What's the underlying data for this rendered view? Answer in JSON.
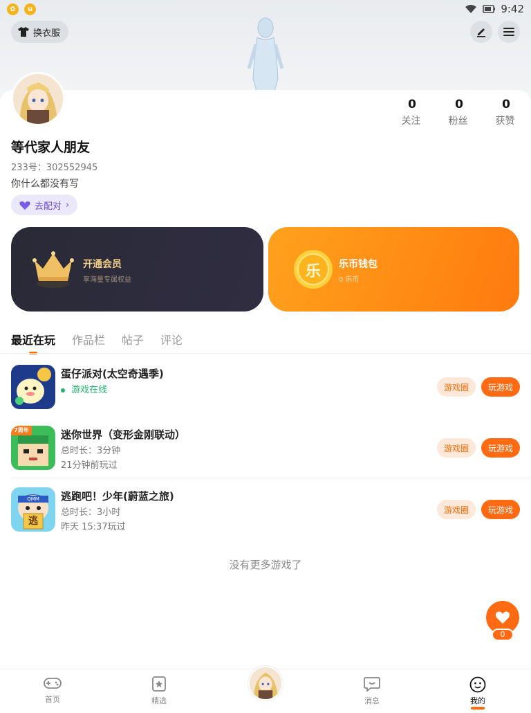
{
  "status_bar": {
    "time": "9:42",
    "left_icons": [
      "game-app-icon",
      "u-app-icon"
    ],
    "right_icons": [
      "wifi-icon",
      "battery-icon"
    ]
  },
  "header": {
    "wardrobe_label": "换衣服",
    "edit_icon": "pen-icon",
    "menu_icon": "hamburger-icon"
  },
  "profile": {
    "nickname": "等代家人朋友",
    "uid": "233号：302552945",
    "bio": "你什么都没有写",
    "match_label": "去配对",
    "stats": [
      {
        "value": "0",
        "label": "关注"
      },
      {
        "value": "0",
        "label": "粉丝"
      },
      {
        "value": "0",
        "label": "获赞"
      }
    ]
  },
  "vip_card": {
    "title": "开通会员",
    "subtitle": "享海量专属权益"
  },
  "coin_card": {
    "title": "乐币钱包",
    "subtitle": "0 乐币",
    "coin_glyph": "乐"
  },
  "tabs": [
    "最近在玩",
    "作品栏",
    "帖子",
    "评论"
  ],
  "games": [
    {
      "name": "蛋仔派对(太空奇遇季)",
      "line1": "游戏在线",
      "line2": "",
      "online": true
    },
    {
      "name": "迷你世界（变形金刚联动）",
      "line1": "总时长：3分钟",
      "line2": "21分钟前玩过",
      "online": false
    },
    {
      "name": "逃跑吧！少年(蔚蓝之旅)",
      "line1": "总时长：3小时",
      "line2": "昨天 15:37玩过",
      "online": false
    }
  ],
  "game_buttons": {
    "circle": "游戏圈",
    "play": "玩游戏"
  },
  "game_icon_text": {
    "mini_world": "7周年",
    "escape_badge": "逃",
    "escape_cap": "QMM"
  },
  "no_more": "没有更多游戏了",
  "like_count": "0",
  "bottom_nav": [
    {
      "label": "首页",
      "icon": "gamepad-icon"
    },
    {
      "label": "精选",
      "icon": "star-card-icon"
    },
    {
      "label": "",
      "icon": "avatar-center"
    },
    {
      "label": "消息",
      "icon": "chat-bubble-icon"
    },
    {
      "label": "我的",
      "icon": "smile-face-icon"
    }
  ],
  "colors": {
    "accent": "#ff6a12",
    "online": "#1db46b",
    "vip_bg": "#2a2a36",
    "coin_bg": "#ff8c16",
    "match_purple": "#6a4bd8"
  }
}
